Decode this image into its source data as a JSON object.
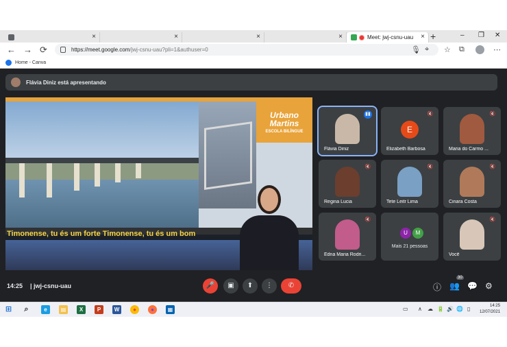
{
  "browser": {
    "tabs": [
      {
        "title": "",
        "favicon_color": "#5f6368"
      },
      {
        "title": "",
        "favicon_color": "#5f6368"
      },
      {
        "title": "",
        "favicon_color": "#5f6368"
      },
      {
        "title": "",
        "favicon_color": "#5f6368"
      },
      {
        "title": "Meet: jwj-csnu-uau",
        "favicon_color": "#34a853"
      }
    ],
    "close_glyph": "×",
    "new_tab_glyph": "+",
    "window_controls": [
      "–",
      "❐",
      "✕"
    ],
    "nav": {
      "back": "←",
      "forward": "→",
      "reload": "⟳"
    },
    "url_host": "https://meet.google.com",
    "url_path": "/jwj-csnu-uau?pli=1&authuser=0",
    "toolbar_icons": [
      "🎙",
      "⌖",
      "☆",
      "⧉",
      "⋯"
    ],
    "bookmark": "Home - Canva"
  },
  "meet": {
    "presenting_text": "Flávia Diniz está apresentando",
    "stage": {
      "logo_line1": "Urbano",
      "logo_line2": "Martins",
      "logo_sub": "ESCOLA BILÍNGUE",
      "caption": "Timonense, tu és um forte Timonense, tu és um bom"
    },
    "participants": [
      {
        "name": "Flávia Diniz",
        "speaking": true,
        "color": "#c9b8a8"
      },
      {
        "name": "Elizabeth Barbosa",
        "initial": "E"
      },
      {
        "name": "Maria do Carmo ...",
        "color": "#a05a40"
      },
      {
        "name": "Regina Lucia",
        "color": "#6b3e2e"
      },
      {
        "name": "Tete Leitr Lima",
        "color": "#7aa0c4"
      },
      {
        "name": "Cinara Costa",
        "color": "#b07a5a"
      },
      {
        "name": "Edna Maria Rodri...",
        "color": "#c25c8a"
      },
      {
        "name": "Mais 21 pessoas",
        "initials": [
          "U",
          "M"
        ],
        "initial_colors": [
          "#8e24aa",
          "#43a047"
        ]
      },
      {
        "name": "Você",
        "color": "#d8c7b8"
      }
    ],
    "mic_off_glyph": "🔇",
    "speaking_glyph": "▮▮",
    "time": "14:25",
    "separator": "|",
    "code": "jwj-csnu-uau",
    "controls": {
      "mic": "🎤",
      "camera": "▣",
      "present": "⬆",
      "more": "⋮",
      "end": "✆"
    },
    "side_controls": {
      "info": "ⓘ",
      "people": "👥",
      "chat": "💬",
      "activities": "⚙"
    },
    "people_count": "30"
  },
  "taskbar": {
    "apps": [
      {
        "name": "windows",
        "glyph": "⊞",
        "color": "#1f6fd1"
      },
      {
        "name": "search",
        "glyph": "⌕",
        "color": "#555555"
      },
      {
        "name": "edge",
        "glyph": "e",
        "color": "#1b9de2"
      },
      {
        "name": "explorer",
        "glyph": "▤",
        "color": "#f2c14e"
      },
      {
        "name": "excel",
        "glyph": "X",
        "color": "#1d6f42"
      },
      {
        "name": "powerpoint",
        "glyph": "P",
        "color": "#c43e1c"
      },
      {
        "name": "word",
        "glyph": "W",
        "color": "#2b579a"
      },
      {
        "name": "chrome",
        "glyph": "●",
        "color": "#ea4335"
      },
      {
        "name": "firefox",
        "glyph": "●",
        "color": "#ff7139"
      },
      {
        "name": "photos",
        "glyph": "▦",
        "color": "#0063b1"
      }
    ],
    "tray": [
      "▭",
      "∧",
      "☁",
      "🔋",
      "🔊",
      "🌐",
      "▯"
    ],
    "clock_time": "14:25",
    "clock_date": "12/07/2021"
  }
}
